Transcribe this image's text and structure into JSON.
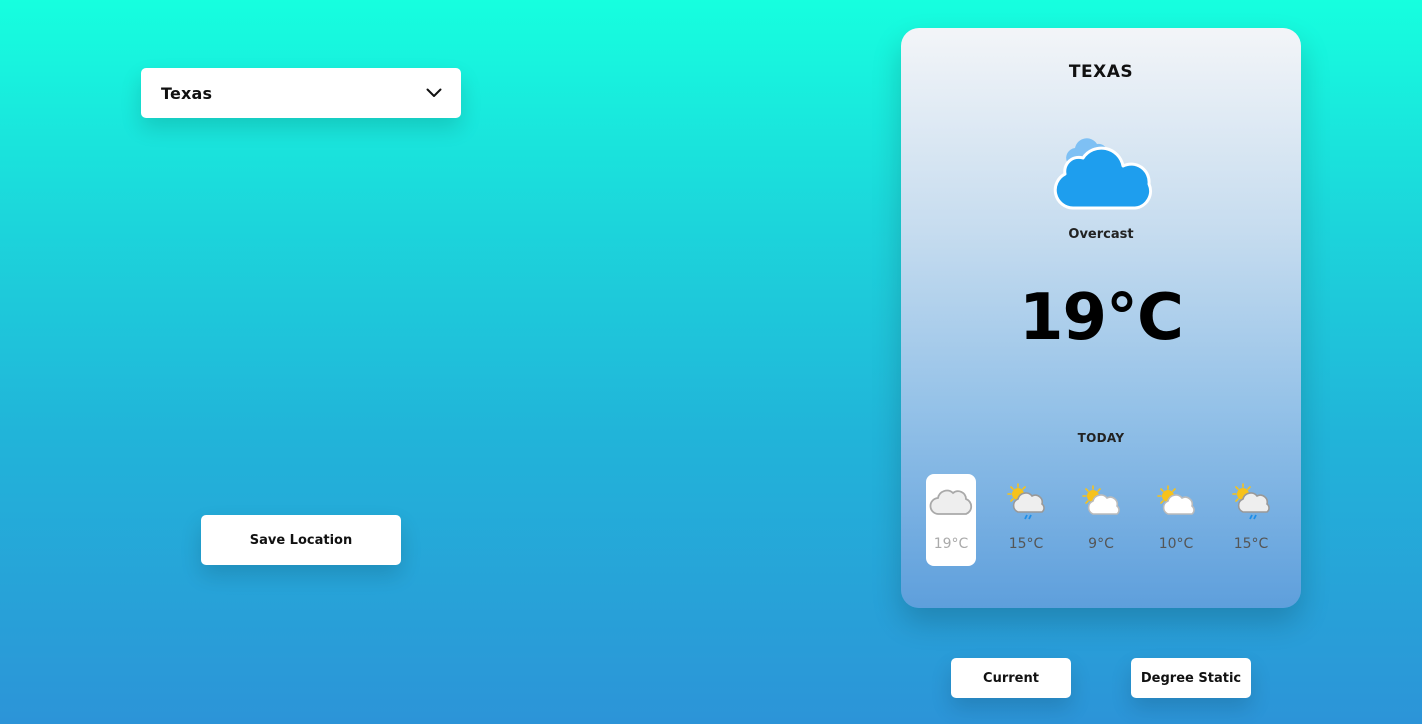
{
  "location_select": {
    "value": "Texas",
    "icon": "chevron-down-icon"
  },
  "save_button": {
    "label": "Save Location"
  },
  "card": {
    "title": "TEXAS",
    "condition": "Overcast",
    "main_icon": "cloud-icon",
    "temperature": "19°C",
    "today_label": "TODAY",
    "forecast": [
      {
        "temp": "19°C",
        "icon": "cloud-icon",
        "active": true
      },
      {
        "temp": "15°C",
        "icon": "sun-cloud-rain-icon",
        "active": false
      },
      {
        "temp": "9°C",
        "icon": "sun-cloud-icon",
        "active": false
      },
      {
        "temp": "10°C",
        "icon": "sun-cloud-icon",
        "active": false
      },
      {
        "temp": "15°C",
        "icon": "sun-cloud-rain-icon",
        "active": false
      }
    ]
  },
  "bottom_buttons": {
    "current": "Current",
    "degree_static": "Degree Static"
  },
  "colors": {
    "background_top": "#16ffdf",
    "background_bottom": "#2c94d8",
    "cloud_blue": "#1e9eee",
    "sun_yellow": "#f7c21b"
  }
}
